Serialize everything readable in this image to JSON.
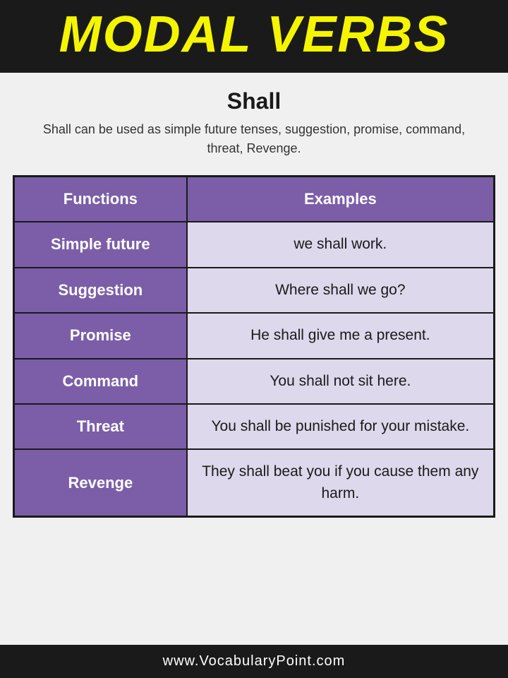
{
  "header": {
    "title": "MODAL VERBS"
  },
  "intro": {
    "word": "Shall",
    "description": "Shall can be used as simple future tenses, suggestion, promise, command, threat, Revenge."
  },
  "table": {
    "columns": [
      "Functions",
      "Examples"
    ],
    "rows": [
      {
        "function": "Simple future",
        "example": "we shall work."
      },
      {
        "function": "Suggestion",
        "example": "Where shall we go?"
      },
      {
        "function": "Promise",
        "example": "He shall give me a present."
      },
      {
        "function": "Command",
        "example": "You shall not sit here."
      },
      {
        "function": "Threat",
        "example": "You shall be punished for your mistake."
      },
      {
        "function": "Revenge",
        "example": "They shall beat you if you cause them any harm."
      }
    ]
  },
  "footer": {
    "text": "www.VocabularyPoint.com"
  }
}
